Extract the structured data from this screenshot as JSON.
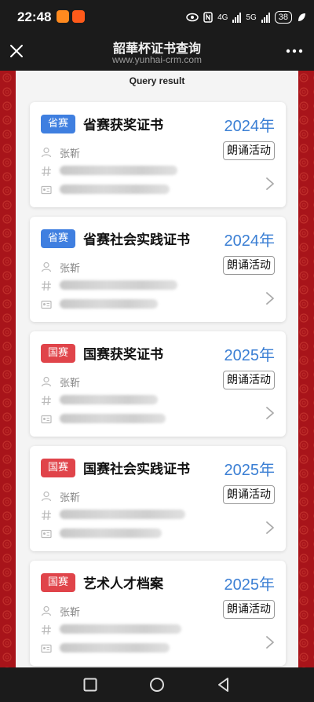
{
  "status": {
    "time": "22:48",
    "net1": "4G",
    "net2": "5G",
    "battery": "38"
  },
  "header": {
    "title": "韶華杯证书查询",
    "url": "www.yunhai-crm.com"
  },
  "query_title": "Query result",
  "certificates": [
    {
      "tag": "省赛",
      "tag_color": "#3f7fe0",
      "name": "省赛获奖证书",
      "year": "2024年",
      "person": "张靳",
      "activity": "朗诵活动"
    },
    {
      "tag": "省赛",
      "tag_color": "#3f7fe0",
      "name": "省赛社会实践证书",
      "year": "2024年",
      "person": "张靳",
      "activity": "朗诵活动"
    },
    {
      "tag": "国赛",
      "tag_color": "#e0444a",
      "name": "国赛获奖证书",
      "year": "2025年",
      "person": "张靳",
      "activity": "朗诵活动"
    },
    {
      "tag": "国赛",
      "tag_color": "#e0444a",
      "name": "国赛社会实践证书",
      "year": "2025年",
      "person": "张靳",
      "activity": "朗诵活动"
    },
    {
      "tag": "国赛",
      "tag_color": "#e0444a",
      "name": "艺术人才档案",
      "year": "2025年",
      "person": "张靳",
      "activity": "朗诵活动"
    }
  ]
}
